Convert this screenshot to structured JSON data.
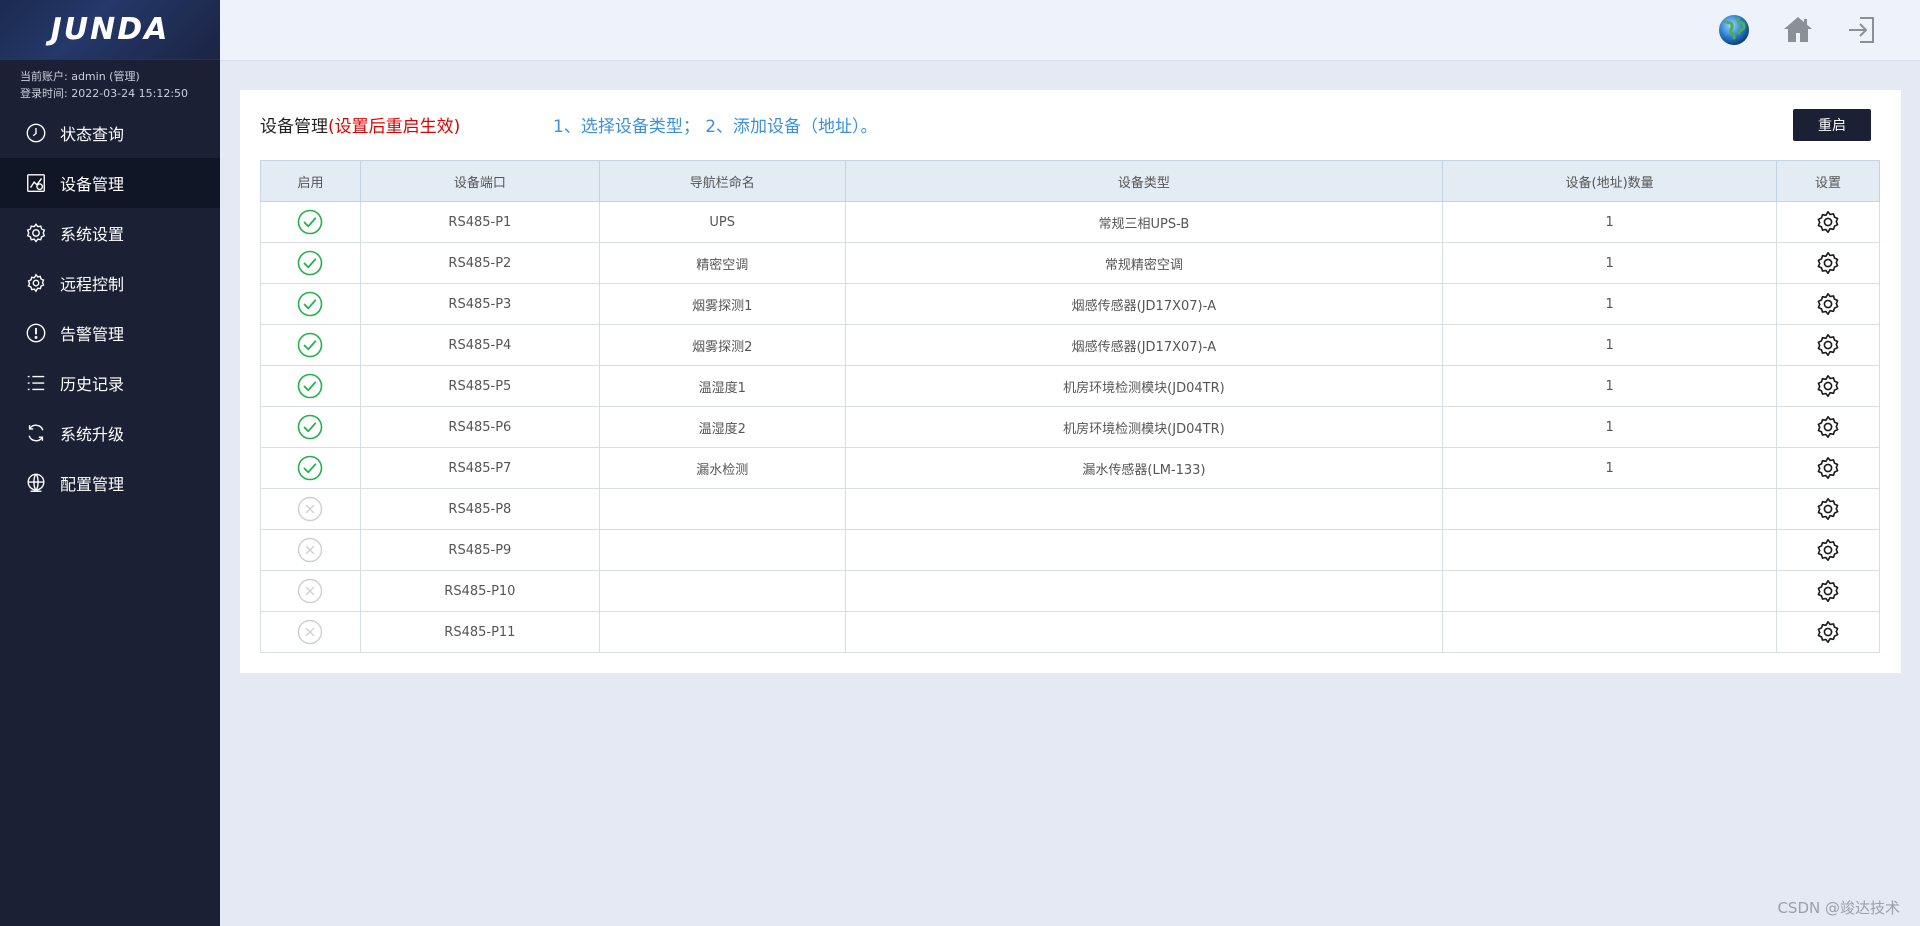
{
  "sidebar": {
    "logo_text": "JUNDA",
    "account_label": "当前账户: admin (管理)",
    "login_time": "登录时间: 2022-03-24 15:12:50",
    "items": [
      {
        "label": "状态查询",
        "icon": "clock-icon"
      },
      {
        "label": "设备管理",
        "icon": "device-edit-icon",
        "active": true
      },
      {
        "label": "系统设置",
        "icon": "gear-icon"
      },
      {
        "label": "远程控制",
        "icon": "remote-gear-icon"
      },
      {
        "label": "告警管理",
        "icon": "alert-icon"
      },
      {
        "label": "历史记录",
        "icon": "list-icon"
      },
      {
        "label": "系统升级",
        "icon": "refresh-icon"
      },
      {
        "label": "配置管理",
        "icon": "globe-config-icon"
      }
    ]
  },
  "topbar": {
    "icons": [
      "globe-icon",
      "home-icon",
      "logout-icon"
    ]
  },
  "panel": {
    "title": "设备管理",
    "title_warn": "(设置后重启生效)",
    "hint": "1、选择设备类型； 2、添加设备（地址）。",
    "restart_label": "重启"
  },
  "table": {
    "headers": [
      "启用",
      "设备端口",
      "导航栏命名",
      "设备类型",
      "设备(地址)数量",
      "设置"
    ],
    "rows": [
      {
        "enabled": true,
        "port": "RS485-P1",
        "name": "UPS",
        "type": "常规三相UPS-B",
        "count": "1"
      },
      {
        "enabled": true,
        "port": "RS485-P2",
        "name": "精密空调",
        "type": "常规精密空调",
        "count": "1"
      },
      {
        "enabled": true,
        "port": "RS485-P3",
        "name": "烟雾探测1",
        "type": "烟感传感器(JD17X07)-A",
        "count": "1"
      },
      {
        "enabled": true,
        "port": "RS485-P4",
        "name": "烟雾探测2",
        "type": "烟感传感器(JD17X07)-A",
        "count": "1"
      },
      {
        "enabled": true,
        "port": "RS485-P5",
        "name": "温湿度1",
        "type": "机房环境检测模块(JD04TR)",
        "count": "1"
      },
      {
        "enabled": true,
        "port": "RS485-P6",
        "name": "温湿度2",
        "type": "机房环境检测模块(JD04TR)",
        "count": "1"
      },
      {
        "enabled": true,
        "port": "RS485-P7",
        "name": "漏水检测",
        "type": "漏水传感器(LM-133)",
        "count": "1"
      },
      {
        "enabled": false,
        "port": "RS485-P8",
        "name": "",
        "type": "",
        "count": ""
      },
      {
        "enabled": false,
        "port": "RS485-P9",
        "name": "",
        "type": "",
        "count": ""
      },
      {
        "enabled": false,
        "port": "RS485-P10",
        "name": "",
        "type": "",
        "count": ""
      },
      {
        "enabled": false,
        "port": "RS485-P11",
        "name": "",
        "type": "",
        "count": ""
      }
    ]
  },
  "watermark": "CSDN @竣达技术",
  "colors": {
    "sidebar_bg": "#1b2034",
    "enabled_green": "#22b14c",
    "disabled_gray": "#c8c8c8",
    "warn_red": "#e60000",
    "hint_blue": "#3b90e0"
  }
}
